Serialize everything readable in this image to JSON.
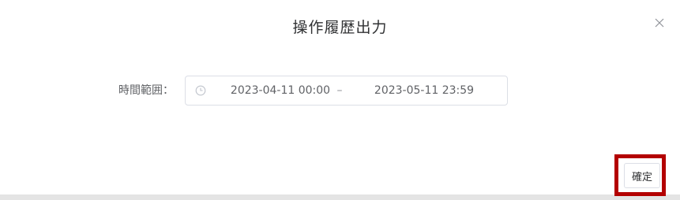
{
  "dialog": {
    "title": "操作履歴出力",
    "close_icon": "close-icon"
  },
  "form": {
    "time_range": {
      "label": "時間範囲：",
      "icon": "clock-icon",
      "start": "2023-04-11 00:00",
      "separator": "–",
      "end": "2023-05-11 23:59"
    }
  },
  "footer": {
    "confirm_label": "確定",
    "highlight_color": "#b30000"
  }
}
